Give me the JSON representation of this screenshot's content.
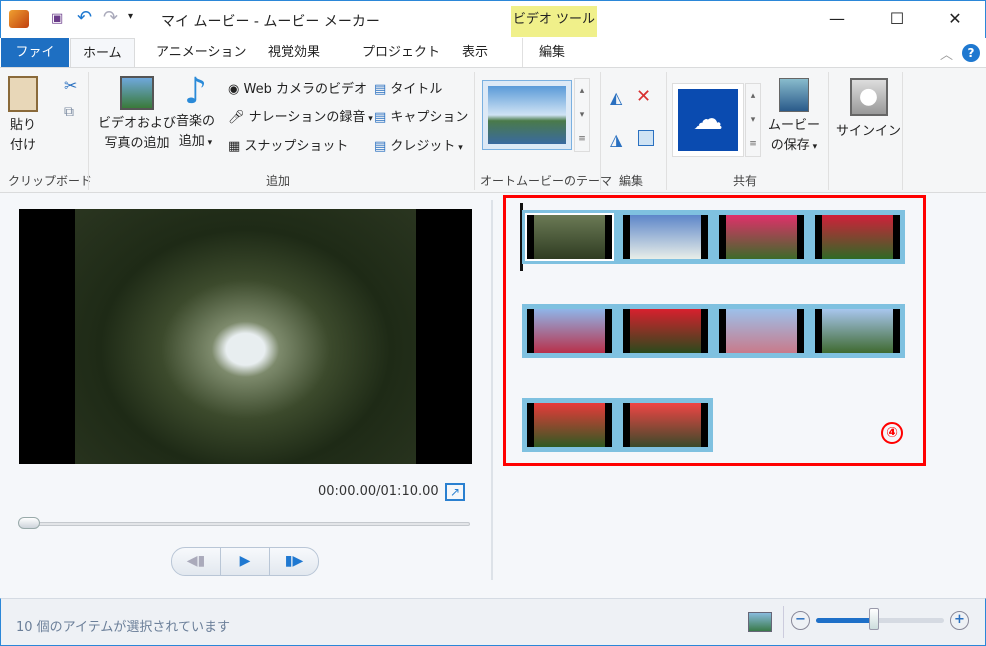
{
  "window": {
    "title": "マイ ムービー - ムービー メーカー",
    "context_tab": "ビデオ ツール",
    "minimize": "—",
    "maximize": "☐",
    "close": "✕"
  },
  "tabs": [
    {
      "label": "ファイル"
    },
    {
      "label": "ホーム"
    },
    {
      "label": "アニメーション"
    },
    {
      "label": "視覚効果"
    },
    {
      "label": "プロジェクト"
    },
    {
      "label": "表示"
    },
    {
      "label": "編集"
    }
  ],
  "ribbon": {
    "clipboard": {
      "paste_line1": "貼り",
      "paste_line2": "付け",
      "group": "クリップボード"
    },
    "add": {
      "video_photo_line1": "ビデオおよび",
      "video_photo_line2": "写真の追加",
      "music_line1": "音楽の",
      "music_line2": "追加",
      "webcam": "Web カメラのビデオ",
      "narration": "ナレーションの録音",
      "snapshot": "スナップショット",
      "title": "タイトル",
      "caption": "キャプション",
      "credit": "クレジット",
      "group": "追加"
    },
    "automovie": {
      "group": "オートムービーのテーマ"
    },
    "edit": {
      "group": "編集"
    },
    "share": {
      "save_line1": "ムービー",
      "save_line2": "の保存",
      "group": "共有"
    },
    "signin": "サインイン"
  },
  "preview": {
    "timecode": "00:00.00/01:10.00",
    "progress": 0
  },
  "storyboard": {
    "annotation": "④",
    "clips": [
      {
        "colors": [
          "#6b7a55",
          "#2f3c22"
        ]
      },
      {
        "colors": [
          "#5d86c9",
          "#e8eee8"
        ]
      },
      {
        "colors": [
          "#e0306a",
          "#3d6b2a"
        ]
      },
      {
        "colors": [
          "#d0203a",
          "#2f6a26"
        ]
      },
      {
        "colors": [
          "#8fb4e8",
          "#b8304a"
        ]
      },
      {
        "colors": [
          "#d8202e",
          "#2a4a1c"
        ]
      },
      {
        "colors": [
          "#9cc0ea",
          "#c87a8a"
        ]
      },
      {
        "colors": [
          "#a8c6ee",
          "#3f6a30"
        ]
      },
      {
        "colors": [
          "#e83a3a",
          "#2f5a22"
        ]
      },
      {
        "colors": [
          "#f04545",
          "#3a4a2a"
        ]
      }
    ]
  },
  "status": {
    "text": "10 個のアイテムが選択されています",
    "zoom_level": 0.45
  }
}
